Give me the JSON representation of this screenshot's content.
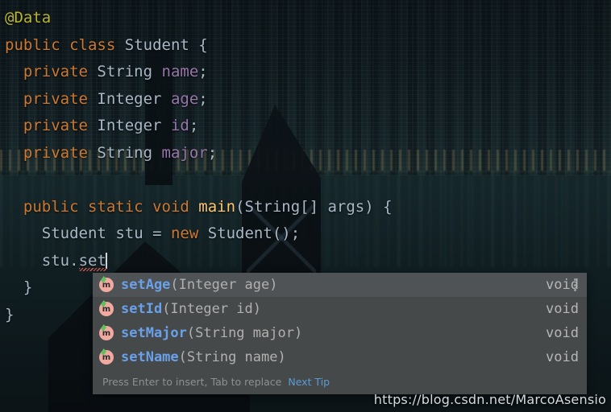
{
  "editor": {
    "language": "Java",
    "code_lines": [
      {
        "id": "line-annotation",
        "indent": 0,
        "tokens": [
          {
            "text": "@Data",
            "kind": "anno"
          }
        ]
      },
      {
        "id": "line-class-decl",
        "indent": 0,
        "tokens": [
          {
            "text": "public",
            "kind": "kw"
          },
          {
            "text": " ",
            "kind": "plain"
          },
          {
            "text": "class",
            "kind": "kw"
          },
          {
            "text": " ",
            "kind": "plain"
          },
          {
            "text": "Student",
            "kind": "type"
          },
          {
            "text": " {",
            "kind": "punct"
          }
        ]
      },
      {
        "id": "line-field-name",
        "indent": 1,
        "tokens": [
          {
            "text": "private",
            "kind": "kw"
          },
          {
            "text": " ",
            "kind": "plain"
          },
          {
            "text": "String",
            "kind": "type"
          },
          {
            "text": " ",
            "kind": "plain"
          },
          {
            "text": "name",
            "kind": "field"
          },
          {
            "text": ";",
            "kind": "punct"
          }
        ]
      },
      {
        "id": "line-field-age",
        "indent": 1,
        "tokens": [
          {
            "text": "private",
            "kind": "kw"
          },
          {
            "text": " ",
            "kind": "plain"
          },
          {
            "text": "Integer",
            "kind": "type"
          },
          {
            "text": " ",
            "kind": "plain"
          },
          {
            "text": "age",
            "kind": "field"
          },
          {
            "text": ";",
            "kind": "punct"
          }
        ]
      },
      {
        "id": "line-field-id",
        "indent": 1,
        "tokens": [
          {
            "text": "private",
            "kind": "kw"
          },
          {
            "text": " ",
            "kind": "plain"
          },
          {
            "text": "Integer",
            "kind": "type"
          },
          {
            "text": " ",
            "kind": "plain"
          },
          {
            "text": "id",
            "kind": "field"
          },
          {
            "text": ";",
            "kind": "punct"
          }
        ]
      },
      {
        "id": "line-field-major",
        "indent": 1,
        "tokens": [
          {
            "text": "private",
            "kind": "kw"
          },
          {
            "text": " ",
            "kind": "plain"
          },
          {
            "text": "String",
            "kind": "type"
          },
          {
            "text": " ",
            "kind": "plain"
          },
          {
            "text": "major",
            "kind": "field"
          },
          {
            "text": ";",
            "kind": "punct"
          }
        ]
      },
      {
        "id": "line-blank",
        "indent": 0,
        "tokens": [
          {
            "text": "",
            "kind": "plain"
          }
        ]
      },
      {
        "id": "line-main-decl",
        "indent": 1,
        "tokens": [
          {
            "text": "public",
            "kind": "kw"
          },
          {
            "text": " ",
            "kind": "plain"
          },
          {
            "text": "static",
            "kind": "kw"
          },
          {
            "text": " ",
            "kind": "plain"
          },
          {
            "text": "void",
            "kind": "kw"
          },
          {
            "text": " ",
            "kind": "plain"
          },
          {
            "text": "main",
            "kind": "method"
          },
          {
            "text": "(String[] args) {",
            "kind": "punct"
          }
        ]
      },
      {
        "id": "line-new-student",
        "indent": 2,
        "tokens": [
          {
            "text": "Student",
            "kind": "type"
          },
          {
            "text": " stu = ",
            "kind": "plain"
          },
          {
            "text": "new",
            "kind": "kw"
          },
          {
            "text": " ",
            "kind": "plain"
          },
          {
            "text": "Student",
            "kind": "type"
          },
          {
            "text": "();",
            "kind": "punct"
          }
        ]
      },
      {
        "id": "line-stu-set",
        "indent": 2,
        "tokens": [
          {
            "text": "stu.",
            "kind": "plain"
          },
          {
            "text": "set",
            "kind": "error"
          }
        ]
      },
      {
        "id": "line-close-method",
        "indent": 1,
        "tokens": [
          {
            "text": "}",
            "kind": "punct"
          }
        ]
      },
      {
        "id": "line-close-class",
        "indent": 0,
        "tokens": [
          {
            "text": "}",
            "kind": "punct"
          }
        ]
      }
    ]
  },
  "completion_popup": {
    "visible": true,
    "icon_name": "method-icon",
    "icon_letter": "m",
    "items": [
      {
        "name": "setAge",
        "signature": "(Integer age)",
        "return_type": "void",
        "selected": true
      },
      {
        "name": "setId",
        "signature": "(Integer id)",
        "return_type": "void",
        "selected": false
      },
      {
        "name": "setMajor",
        "signature": "(String major)",
        "return_type": "void",
        "selected": false
      },
      {
        "name": "setName",
        "signature": "(String name)",
        "return_type": "void",
        "selected": false
      }
    ],
    "hint": "Press Enter to insert, Tab to replace",
    "tip_link": "Next Tip",
    "overflow_menu_icon": "kebab-menu-icon"
  },
  "watermark": {
    "text": "https://blog.csdn.net/MarcoAsensio"
  },
  "colors": {
    "keyword": "#cc7832",
    "annotation": "#bbb529",
    "field": "#9876aa",
    "method": "#ffc66d",
    "default_text": "#a9b7c6",
    "popup_bg": "#46494a",
    "popup_selected_bg": "#4f5355",
    "completion_name": "#6aa0e8",
    "completion_detail": "#b0b0b0",
    "tip_link": "#5b9bd5",
    "error_squiggle": "#e05a4f"
  }
}
